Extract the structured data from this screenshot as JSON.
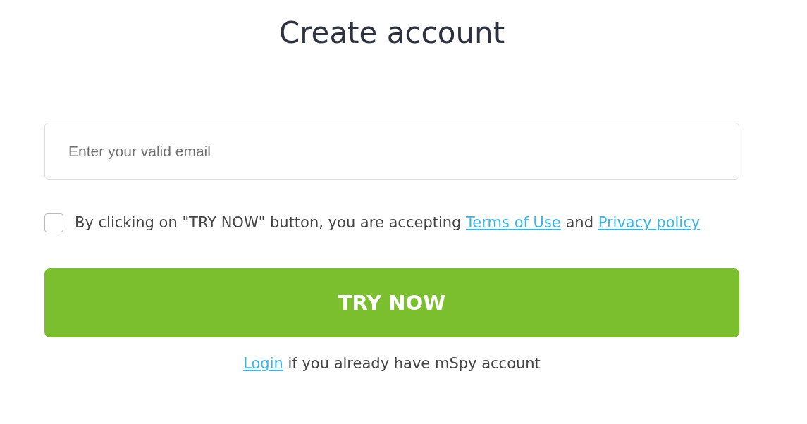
{
  "title": "Create account",
  "email": {
    "placeholder": "Enter your valid email"
  },
  "consent": {
    "checked": false,
    "text": "By clicking on \"TRY NOW\" button, you are accepting",
    "link_1": "Terms of Use",
    "joiner": "and",
    "link_2": "Privacy policy"
  },
  "submit": {
    "label": "TRY NOW"
  },
  "footer": {
    "link": "Login",
    "text": "if you already have mSpy account"
  }
}
